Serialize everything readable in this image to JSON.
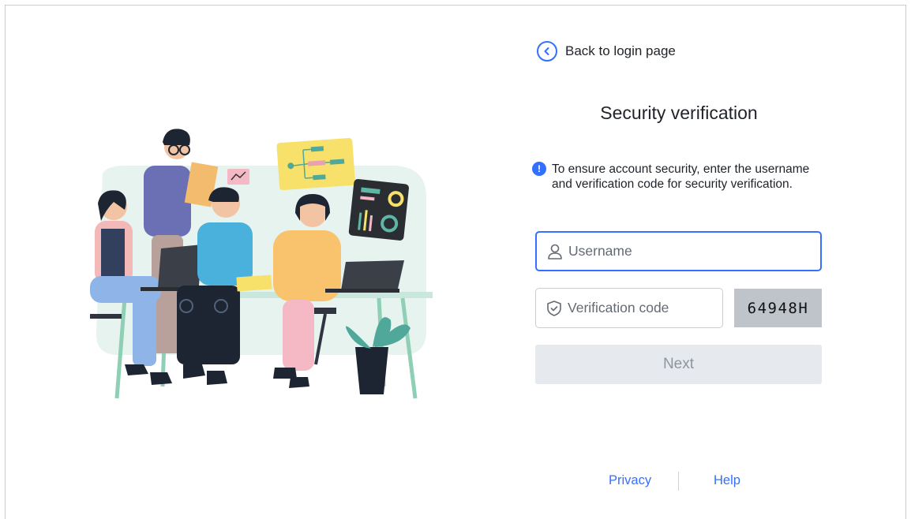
{
  "nav": {
    "back_label": "Back to login page"
  },
  "form": {
    "title": "Security verification",
    "notice": "To ensure account security, enter the username and verification code for security verification.",
    "username": {
      "placeholder": "Username",
      "value": ""
    },
    "verification_code": {
      "placeholder": "Verification code",
      "value": ""
    },
    "captcha_text": "64948H",
    "next_label": "Next"
  },
  "footer": {
    "privacy_label": "Privacy",
    "help_label": "Help"
  },
  "colors": {
    "accent": "#3370ff",
    "disabled_bg": "#e6e9ed",
    "captcha_bg": "#bfc4cb"
  },
  "icons": {
    "back": "chevron-left-circle-icon",
    "notice": "info-icon",
    "username": "user-icon",
    "code": "shield-check-icon"
  }
}
